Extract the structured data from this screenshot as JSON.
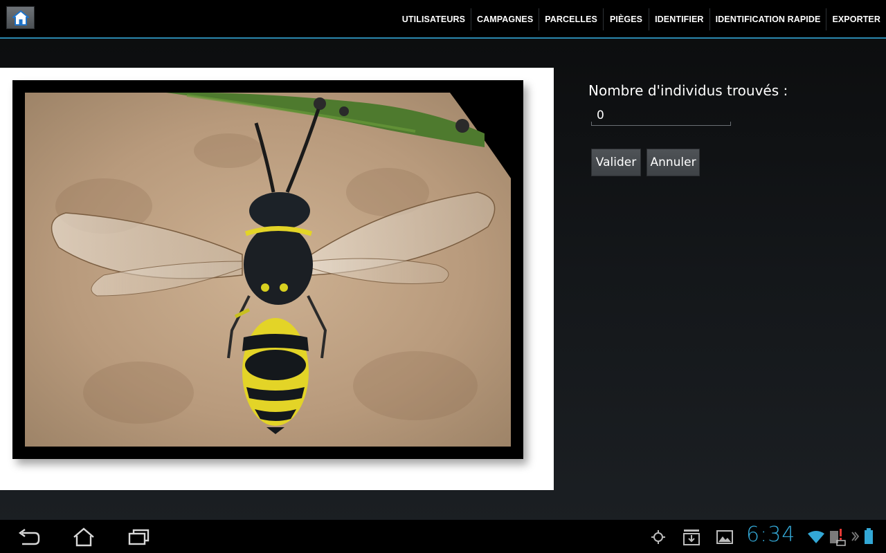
{
  "app": {
    "home_icon": "home-icon",
    "accent": "#2b88b0"
  },
  "menu": {
    "items": [
      {
        "label": "UTILISATEURS"
      },
      {
        "label": "CAMPAGNES"
      },
      {
        "label": "PARCELLES"
      },
      {
        "label": "PIÈGES"
      },
      {
        "label": "IDENTIFIER"
      },
      {
        "label": "IDENTIFICATION RAPIDE"
      },
      {
        "label": "EXPORTER"
      }
    ]
  },
  "form": {
    "count_label": "Nombre d'individus trouvés :",
    "count_value": "0",
    "validate_label": "Valider",
    "cancel_label": "Annuler"
  },
  "photo": {
    "subject_icon": "wasp-photo"
  },
  "system_bar": {
    "time": "6:34",
    "clock_color": "#33a8d6",
    "icons": [
      "back-icon",
      "home-icon",
      "recent-apps-icon",
      "gps-icon",
      "download-icon",
      "gallery-icon",
      "wifi-icon",
      "sim-alert-icon",
      "keyboard-icon",
      "battery-icon"
    ]
  }
}
